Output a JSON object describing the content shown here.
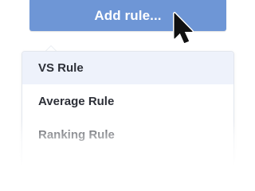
{
  "add_rule_button": {
    "label": "Add rule..."
  },
  "menu": {
    "items": [
      {
        "label": "VS Rule"
      },
      {
        "label": "Average Rule"
      },
      {
        "label": "Ranking Rule"
      }
    ],
    "highlighted_index": 0
  },
  "colors": {
    "button_bg": "#6e96d6",
    "menu_highlight": "#eef2fb",
    "text": "#2d3038"
  },
  "icons": {
    "cursor": "arrow-pointer-icon"
  }
}
